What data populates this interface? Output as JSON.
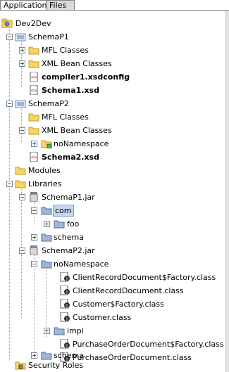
{
  "tabs": {
    "application": "Application",
    "files": "Files"
  },
  "tree": {
    "root": "Dev2Dev",
    "schemap1": "SchemaP1",
    "mfl_classes_1": "MFL Classes",
    "xml_bean_classes_1": "XML Bean Classes",
    "compiler1": "compiler1.xsdconfig",
    "schema1": "Schema1.xsd",
    "schemap2": "SchemaP2",
    "mfl_classes_2": "MFL Classes",
    "xml_bean_classes_2": "XML Bean Classes",
    "nonamespace_1": "noNamespace",
    "schema2": "Schema2.xsd",
    "modules": "Modules",
    "libraries": "Libraries",
    "schemap1_jar": "SchemaP1.jar",
    "com": "com",
    "foo": "foo",
    "schema_1": "schema",
    "schemap2_jar": "SchemaP2.jar",
    "nonamespace_2": "noNamespace",
    "crd_factory": "ClientRecordDocument$Factory.class",
    "crd": "ClientRecordDocument.class",
    "cust_factory": "Customer$Factory.class",
    "cust": "Customer.class",
    "impl": "impl",
    "pod_factory": "PurchaseOrderDocument$Factory.class",
    "pod": "PurchaseOrderDocument.class",
    "schema_2": "schema",
    "security_roles": "Security Roles"
  },
  "expander": {
    "plus": "+",
    "minus": "−"
  },
  "icons": {
    "workspace": "workspace-icon",
    "project": "project-icon",
    "folder": "folder-icon",
    "xml_file": "xml-file-icon",
    "jar": "jar-icon",
    "package": "package-icon",
    "class_file": "class-file-icon",
    "security": "security-roles-icon"
  },
  "colors": {
    "folder": "#f5d565",
    "folder_edge": "#c79a1a",
    "selection": "#c5d7f0",
    "package": "#9fb6d6"
  }
}
